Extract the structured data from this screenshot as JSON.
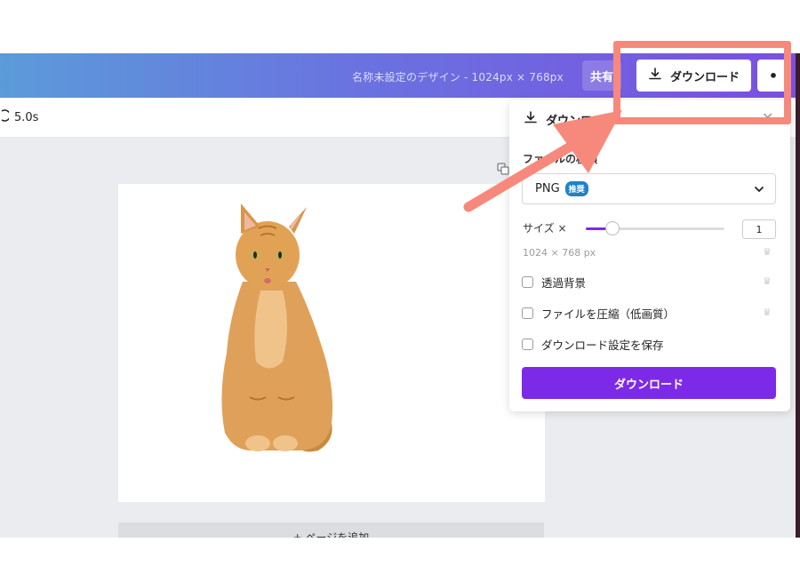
{
  "header": {
    "title": "名称未設定のデザイン - 1024px × 768px",
    "share_label": "共有",
    "download_label": "ダウンロード",
    "more_label": "•"
  },
  "toolbar": {
    "duration": "5.0s"
  },
  "canvas": {
    "add_page_label": "+ ページを追加"
  },
  "download_panel": {
    "title": "ダウンロード",
    "filetype_label": "ファイルの種類",
    "filetype_value": "PNG",
    "recommended_badge": "推奨",
    "size_label": "サイズ ×",
    "size_value": "1",
    "size_fraction": 0.1,
    "dimensions": "1024 × 768 px",
    "options": [
      {
        "label": "透過背景",
        "checked": false
      },
      {
        "label": "ファイルを圧縮（低画質）",
        "checked": false
      },
      {
        "label": "ダウンロード設定を保存",
        "checked": false
      }
    ],
    "download_button": "ダウンロード"
  },
  "colors": {
    "accent": "#7d2ae8",
    "highlight": "#f6897c",
    "badge": "#1f82c9"
  },
  "icons": [
    "download-icon",
    "close-icon",
    "chevron-down-icon",
    "crown-icon",
    "timer-icon",
    "copy-icon",
    "cat-image"
  ]
}
